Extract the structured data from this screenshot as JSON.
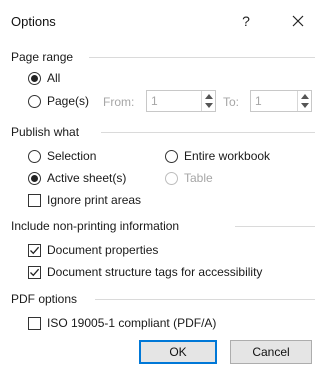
{
  "dialog": {
    "title": "Options",
    "help_glyph": "?",
    "close_icon": "close-icon"
  },
  "page_range": {
    "heading": "Page range",
    "all_label": "All",
    "pages_label": "Page(s)",
    "from_label": "From:",
    "from_value": "1",
    "to_label": "To:",
    "to_value": "1",
    "selected": "All"
  },
  "publish_what": {
    "heading": "Publish what",
    "selection_label": "Selection",
    "entire_workbook_label": "Entire workbook",
    "active_sheets_label": "Active sheet(s)",
    "table_label": "Table",
    "ignore_print_areas_label": "Ignore print areas",
    "selected": "Active sheet(s)",
    "ignore_print_areas_checked": false
  },
  "non_printing": {
    "heading": "Include non-printing information",
    "doc_properties_label": "Document properties",
    "doc_properties_checked": true,
    "doc_structure_label": "Document structure tags for accessibility",
    "doc_structure_checked": true
  },
  "pdf_options": {
    "heading": "PDF options",
    "iso_label": "ISO 19005-1 compliant (PDF/A)",
    "iso_checked": false
  },
  "buttons": {
    "ok_label": "OK",
    "cancel_label": "Cancel"
  },
  "colors": {
    "accent": "#0078d7",
    "disabled_text": "#a6a6a6",
    "button_face": "#e5e5e5"
  }
}
